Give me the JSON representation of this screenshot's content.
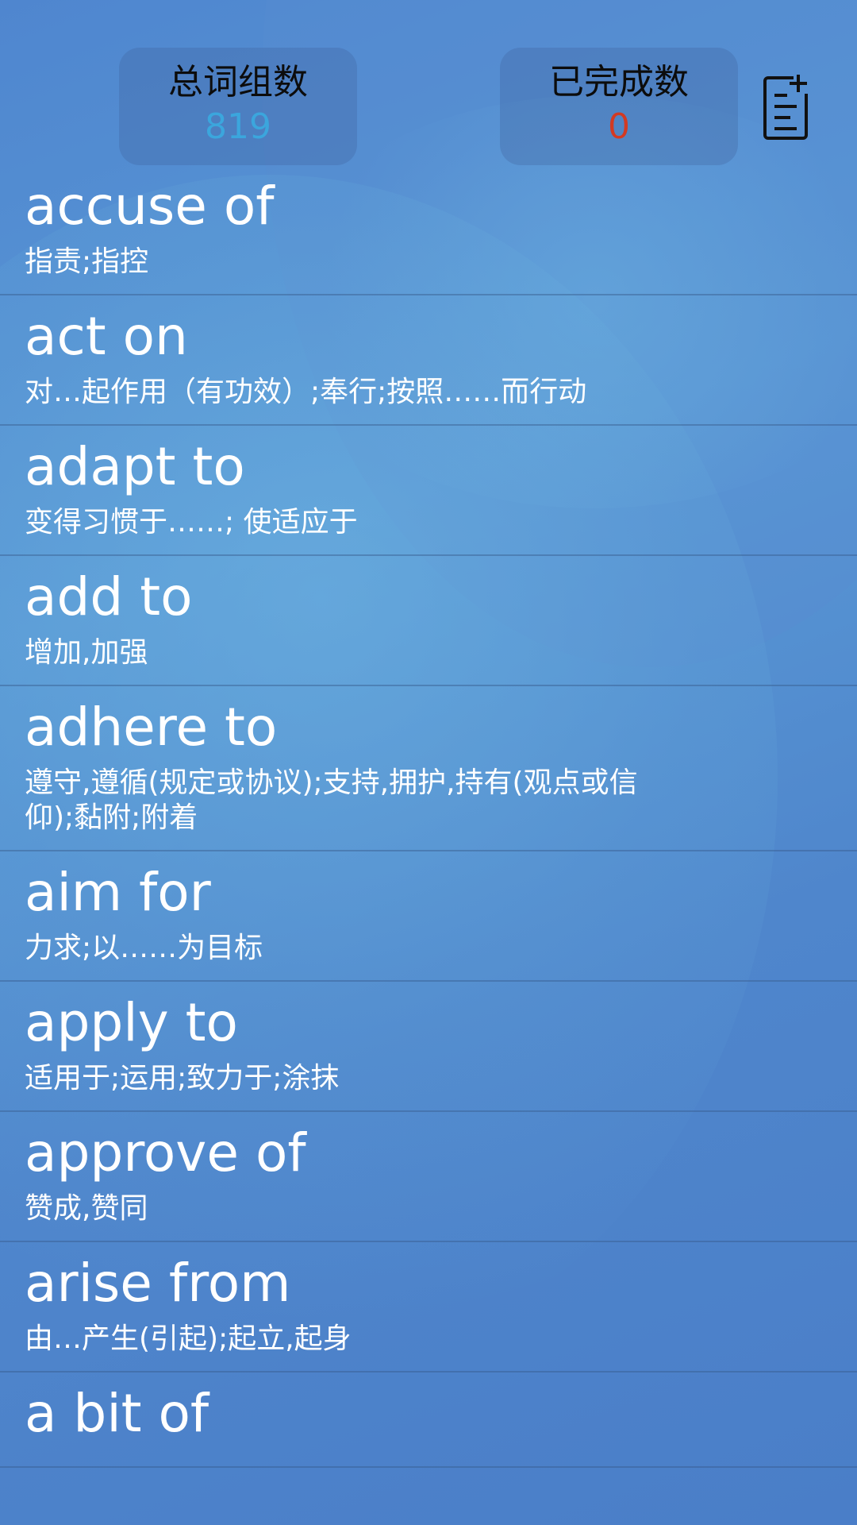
{
  "header": {
    "total_label": "总词组数",
    "total_value": "819",
    "done_label": "已完成数",
    "done_value": "0",
    "icon": "add-list-icon"
  },
  "phrases": [
    {
      "phrase": "accuse of",
      "meaning": "指责;指控"
    },
    {
      "phrase": "act on",
      "meaning": "对…起作用（有功效）;奉行;按照……而行动"
    },
    {
      "phrase": "adapt to",
      "meaning": "变得习惯于……; 使适应于"
    },
    {
      "phrase": "add to",
      "meaning": "增加,加强"
    },
    {
      "phrase": "adhere to",
      "meaning": "遵守,遵循(规定或协议);支持,拥护,持有(观点或信仰);黏附;附着"
    },
    {
      "phrase": "aim for",
      "meaning": "力求;以……为目标"
    },
    {
      "phrase": "apply to",
      "meaning": "适用于;运用;致力于;涂抹"
    },
    {
      "phrase": "approve of",
      "meaning": "赞成,赞同"
    },
    {
      "phrase": "arise from",
      "meaning": "由…产生(引起);起立,起身"
    },
    {
      "phrase": "a bit of",
      "meaning": ""
    }
  ],
  "colors": {
    "total_value": "#3ba6dd",
    "done_value": "#d33a22",
    "text": "#ffffff"
  }
}
